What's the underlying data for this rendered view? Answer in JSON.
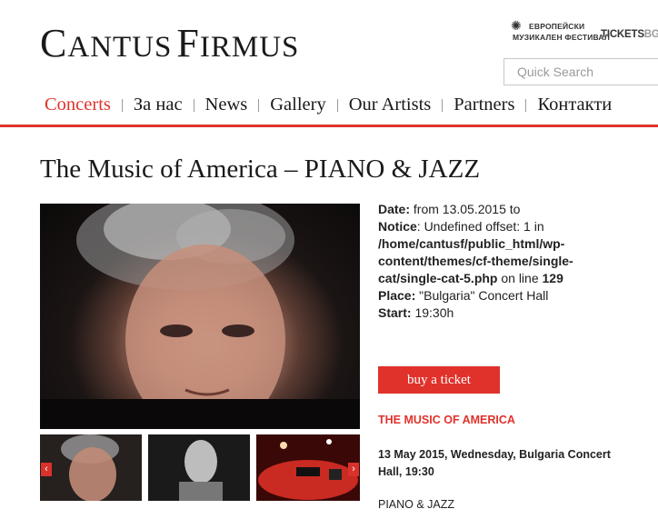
{
  "header": {
    "logo_first_letter_1": "C",
    "logo_rest_1": "ANTUS",
    "logo_first_letter_2": "F",
    "logo_rest_2": "IRMUS",
    "partner_festival_line1": "ЕВРОПЕЙСКИ",
    "partner_festival_line2": "МУЗИКАЛЕН ФЕСТИВАЛ",
    "partner_tickets_main": "TICKETS",
    "partner_tickets_suffix": "BG.",
    "search_placeholder": "Quick Search"
  },
  "nav": {
    "items": [
      {
        "label": "Concerts",
        "active": true
      },
      {
        "label": "За нас"
      },
      {
        "label": "News"
      },
      {
        "label": "Gallery"
      },
      {
        "label": "Our Artists"
      },
      {
        "label": "Partners"
      },
      {
        "label": "Контакти"
      }
    ],
    "accent_color": "#e0322b"
  },
  "event": {
    "title": "The Music of America – PIANO & JAZZ",
    "date_label": "Date:",
    "date_value": " from 13.05.2015 to",
    "notice_label": "Notice",
    "notice_text": ": Undefined offset: 1 in",
    "notice_path": "/home/cantusf/public_html/wp-content/themes/cf-theme/single-cat/single-cat-5.php",
    "notice_online": " on line ",
    "notice_line": "129",
    "place_label": "Place:",
    "place_value": " \"Bulgaria\" Concert Hall",
    "start_label": "Start:",
    "start_value": " 19:30h",
    "buy_label": "buy a ticket",
    "concert_title": "THE MUSIC OF AMERICA",
    "date_place": "13 May 2015, Wednesday, Bulgaria Concert Hall, 19:30",
    "genre": "PIANO & JAZZ"
  },
  "gallery": {
    "prev_icon": "‹",
    "next_icon": "›"
  }
}
